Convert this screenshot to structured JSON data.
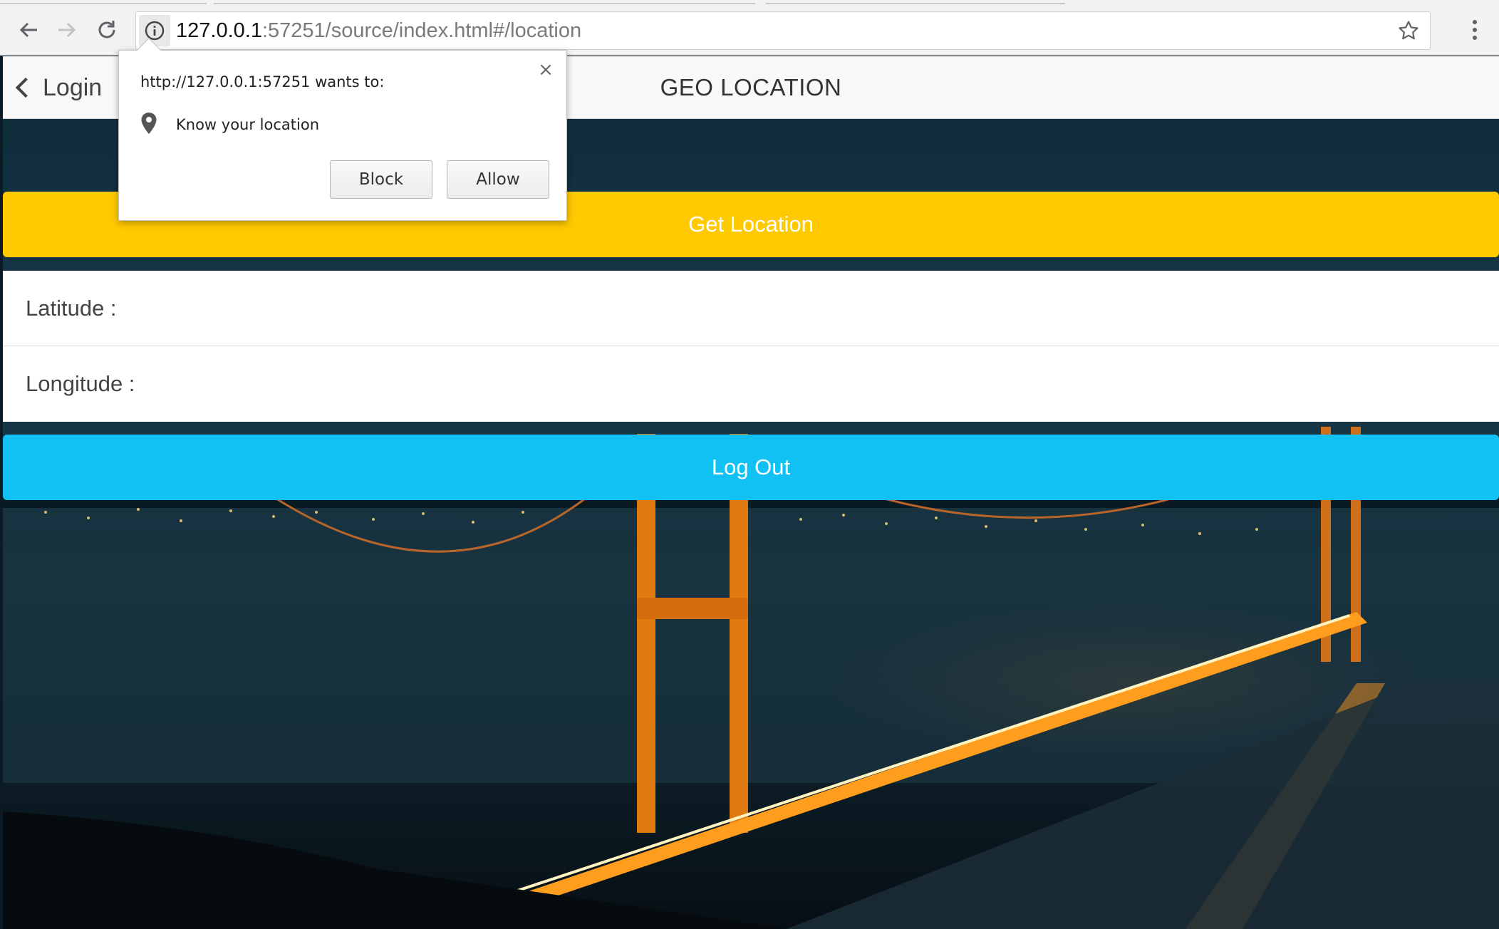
{
  "browser": {
    "url_host": "127.0.0.1",
    "url_path": ":57251/source/index.html#/location",
    "icons": {
      "back": "back-arrow-icon",
      "forward": "forward-arrow-icon",
      "reload": "reload-icon",
      "info": "info-icon",
      "bookmark": "star-icon",
      "menu": "kebab-menu-icon"
    }
  },
  "permission_popup": {
    "title": "http://127.0.0.1:57251 wants to:",
    "permission_icon": "location-pin-icon",
    "permission_label": "Know your location",
    "close_symbol": "×",
    "block_label": "Block",
    "allow_label": "Allow"
  },
  "app": {
    "header": {
      "back_label": "Login",
      "title": "GEO LOCATION"
    },
    "get_location_label": "Get Location",
    "fields": [
      {
        "label": "Latitude :"
      },
      {
        "label": "Longitude :"
      }
    ],
    "logout_label": "Log Out",
    "colors": {
      "energized": "#ffc900",
      "calm": "#11c1f3"
    }
  }
}
